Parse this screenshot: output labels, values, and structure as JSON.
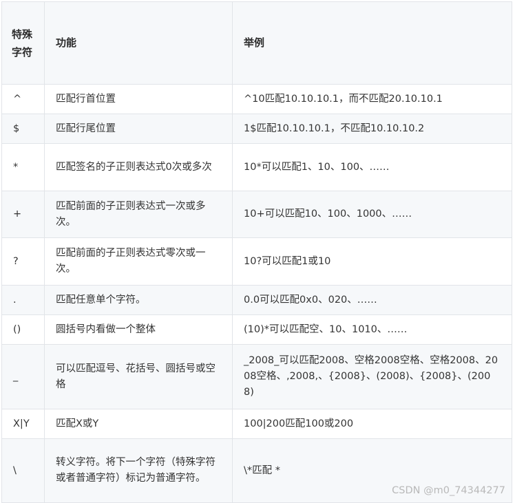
{
  "table": {
    "headers": [
      "特殊字符",
      "功能",
      "举例"
    ],
    "rows": [
      {
        "char": "^",
        "function": "匹配行首位置",
        "example": "^10匹配10.10.10.1，而不匹配20.10.10.1"
      },
      {
        "char": "$",
        "function": "匹配行尾位置",
        "example": "1$匹配10.10.10.1，不匹配10.10.10.2"
      },
      {
        "char": "*",
        "function": "匹配签名的子正则表达式0次或多次",
        "example": "10*可以匹配1、10、100、……"
      },
      {
        "char": "+",
        "function": "匹配前面的子正则表达式一次或多次。",
        "example": "10+可以匹配10、100、1000、……"
      },
      {
        "char": "?",
        "function": "匹配前面的子正则表达式零次或一次。",
        "example": "10?可以匹配1或10"
      },
      {
        "char": ".",
        "function": "匹配任意单个字符。",
        "example": "0.0可以匹配0x0、020、……"
      },
      {
        "char": "()",
        "function": "圆括号内看做一个整体",
        "example": "(10)*可以匹配空、10、1010、……"
      },
      {
        "char": "_",
        "function": "可以匹配逗号、花括号、圆括号或空格",
        "example": "_2008_可以匹配2008、空格2008空格、空格2008、2008空格、,2008,、{2008}、(2008)、{2008}、(2008)"
      },
      {
        "char": "X|Y",
        "function": "匹配X或Y",
        "example": "100|200匹配100或200"
      },
      {
        "char": "\\",
        "function": "转义字符。将下一个字符（特殊字符或者普通字符）标记为普通字符。",
        "example": "\\*匹配 *"
      }
    ]
  },
  "watermark": "CSDN @m0_74344277"
}
